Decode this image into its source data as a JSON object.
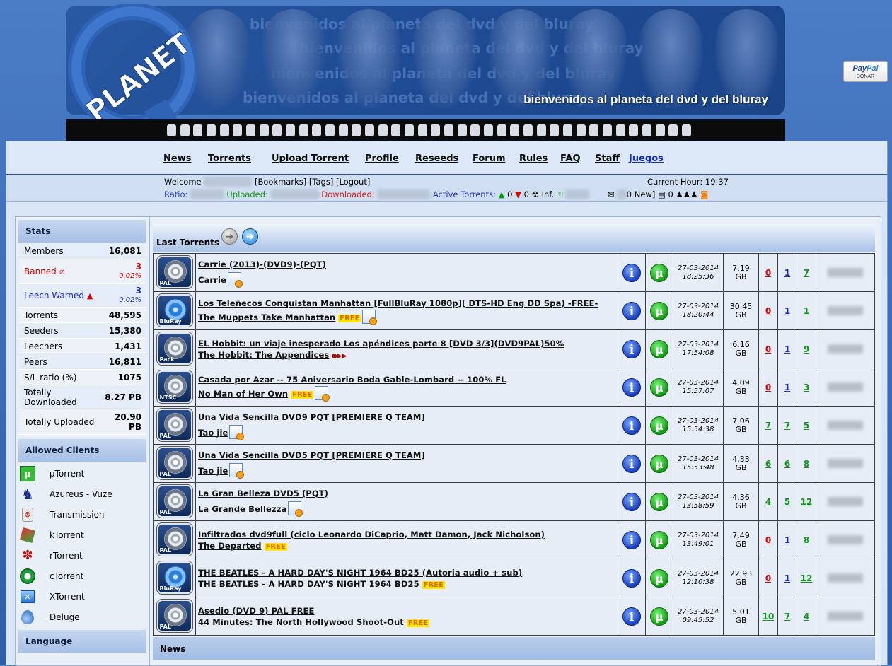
{
  "banner": {
    "logo_text": "PLANET",
    "watermark": "bienvenidos al planeta del dvd y del bluray",
    "tagline": "bienvenidos al planeta del dvd y del bluray"
  },
  "paypal": {
    "brand_dark": "Pay",
    "brand_light": "Pal",
    "label": "DONAR"
  },
  "nav": {
    "items": [
      {
        "label": "News"
      },
      {
        "label": "Torrents"
      },
      {
        "label": "Upload Torrent"
      },
      {
        "label": "Profile"
      },
      {
        "label": "Reseeds"
      },
      {
        "label": "Forum"
      },
      {
        "label": "Rules"
      },
      {
        "label": "FAQ"
      },
      {
        "label": "Staff"
      },
      {
        "label": "Juegos"
      }
    ]
  },
  "user": {
    "welcome": "Welcome",
    "bookmarks": "[Bookmarks]",
    "tags": "[Tags]",
    "logout": "[Logout]",
    "current_hour": "Current Hour: 19:37",
    "ratio_label": "Ratio:",
    "uploaded_label": "Uploaded:",
    "downloaded_label": "Downloaded:",
    "active_label": "Active Torrents:",
    "active_up": "0",
    "active_down": "0",
    "inf_label": "Inf.",
    "new_msgs": "0 New]",
    "requests": "0"
  },
  "sidebar": {
    "stats_title": "Stats",
    "stats": [
      {
        "label": "Members",
        "value": "16,081"
      },
      {
        "label": "Banned",
        "value": "3",
        "pct": "0.02%"
      },
      {
        "label": "Leech Warned",
        "value": "3",
        "pct": "0.02%"
      },
      {
        "label": "Torrents",
        "value": "48,595"
      },
      {
        "label": "Seeders",
        "value": "15,380"
      },
      {
        "label": "Leechers",
        "value": "1,431"
      },
      {
        "label": "Peers",
        "value": "16,811"
      },
      {
        "label": "S/L ratio (%)",
        "value": "1075"
      },
      {
        "label": "Totally Downloaded",
        "value": "8.27 PB"
      },
      {
        "label": "Totally Uploaded",
        "value": "20.90 PB"
      }
    ],
    "clients_title": "Allowed Clients",
    "clients": [
      {
        "name": "μTorrent"
      },
      {
        "name": "Azureus - Vuze"
      },
      {
        "name": "Transmission"
      },
      {
        "name": "kTorrent"
      },
      {
        "name": "rTorrent"
      },
      {
        "name": "cTorrent"
      },
      {
        "name": "XTorrent"
      },
      {
        "name": "Deluge"
      }
    ],
    "language_title": "Language"
  },
  "content": {
    "last_title": "Last Torrents",
    "news_title": "News",
    "info_glyph": "i",
    "utorrent_glyph": "µ",
    "torrents": [
      {
        "cat": "PAL",
        "title": "Carrie (2013)-(DVD9)-(PQT)",
        "subtitle": "Carrie",
        "free": "",
        "date": "27-03-2014",
        "time": "18:25:36",
        "size": "7.19",
        "unit": "GB",
        "comments": "0",
        "seeders": "1",
        "leechers": "7"
      },
      {
        "cat": "BluRay",
        "title": "Los Teleñecos Conquistan Manhattan [FullBluRay 1080p][ DTS-HD Eng DD Spa) -FREE-",
        "subtitle": "The Muppets Take Manhattan",
        "free": "FREE",
        "date": "27-03-2014",
        "time": "18:20:44",
        "size": "30.45",
        "unit": "GB",
        "comments": "0",
        "seeders": "1",
        "leechers": "1"
      },
      {
        "cat": "Pack",
        "title": "EL Hobbit: un viaje inesperado Los apéndices parte 8 [DVD 3/3](DVD9PAL)50%",
        "subtitle": "The Hobbit: The Appendices",
        "free": "",
        "date": "27-03-2014",
        "time": "17:54:08",
        "size": "6.16",
        "unit": "GB",
        "comments": "0",
        "seeders": "1",
        "leechers": "9"
      },
      {
        "cat": "NTSC",
        "title": "Casada por Azar -- 75 Aniversario Boda Gable-Lombard -- 100% FL",
        "subtitle": "No Man of Her Own",
        "free": "FREE",
        "date": "27-03-2014",
        "time": "15:57:07",
        "size": "4.09",
        "unit": "GB",
        "comments": "0",
        "seeders": "1",
        "leechers": "3"
      },
      {
        "cat": "PAL",
        "title": "Una Vida Sencilla DVD9 PQT [PREMIERE Q TEAM]",
        "subtitle": "Tao jie",
        "free": "",
        "date": "27-03-2014",
        "time": "15:54:38",
        "size": "7.06",
        "unit": "GB",
        "comments": "7",
        "seeders": "7",
        "leechers": "5"
      },
      {
        "cat": "PAL",
        "title": "Una Vida Sencilla DVD5 PQT [PREMIERE Q TEAM]",
        "subtitle": "Tao jie",
        "free": "",
        "date": "27-03-2014",
        "time": "15:53:48",
        "size": "4.33",
        "unit": "GB",
        "comments": "6",
        "seeders": "6",
        "leechers": "8"
      },
      {
        "cat": "PAL",
        "title": "La Gran Belleza DVD5 (PQT)",
        "subtitle": "La Grande Bellezza",
        "free": "",
        "date": "27-03-2014",
        "time": "13:58:59",
        "size": "4.36",
        "unit": "GB",
        "comments": "4",
        "seeders": "5",
        "leechers": "12"
      },
      {
        "cat": "PAL",
        "title": "Infiltrados dvd9full (ciclo Leonardo DiCaprio, Matt Damon, Jack Nicholson)",
        "subtitle": "The Departed",
        "free": "FREE",
        "date": "27-03-2014",
        "time": "13:49:01",
        "size": "7.49",
        "unit": "GB",
        "comments": "0",
        "seeders": "1",
        "leechers": "8"
      },
      {
        "cat": "BluRay",
        "title": "THE BEATLES - A HARD DAY'S NIGHT 1964 BD25 (Autoria audio + sub)",
        "subtitle": "THE BEATLES - A HARD DAY'S NIGHT 1964 BD25",
        "free": "FREE",
        "date": "27-03-2014",
        "time": "12:10:38",
        "size": "22.93",
        "unit": "GB",
        "comments": "0",
        "seeders": "1",
        "leechers": "12"
      },
      {
        "cat": "PAL",
        "title": "Asedio (DVD 9) PAL FREE",
        "subtitle": "44 Minutes: The North Hollywood Shoot-Out",
        "free": "FREE",
        "date": "27-03-2014",
        "time": "09:45:52",
        "size": "5.01",
        "unit": "GB",
        "comments": "10",
        "seeders": "7",
        "leechers": "4"
      }
    ]
  },
  "colors": {
    "page_bg": "#3d6db6",
    "frame_bg": "#d9e6f5",
    "header_bar": "#a7c0e6",
    "red": "#e00000",
    "blue": "#1a28c8",
    "green": "#13941a"
  }
}
